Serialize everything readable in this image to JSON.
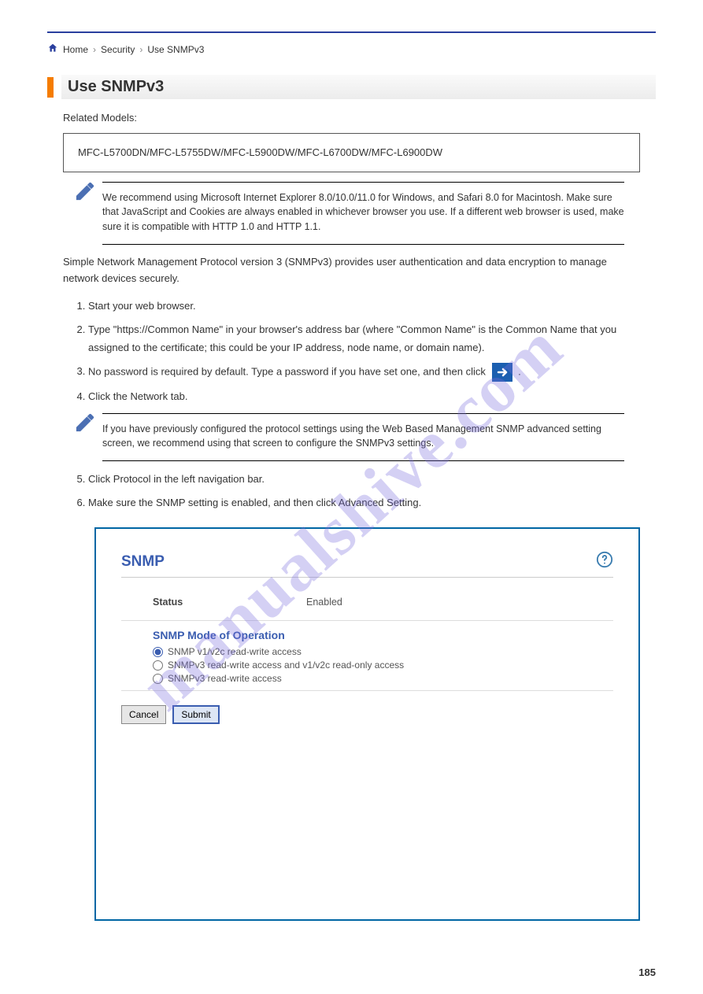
{
  "breadcrumb": {
    "home": "Home",
    "l1": "Security",
    "l2": "Use SNMPv3"
  },
  "section": {
    "title": "Use SNMPv3"
  },
  "intro": "Related Models:",
  "models": "MFC-L5700DN/MFC-L5755DW/MFC-L5900DW/MFC-L6700DW/MFC-L6900DW",
  "note1": "We recommend using Microsoft Internet Explorer 8.0/10.0/11.0 for Windows, and Safari 8.0 for Macintosh. Make sure that JavaScript and Cookies are always enabled in whichever browser you use. If a different web browser is used, make sure it is compatible with HTTP 1.0 and HTTP 1.1.",
  "body1": "Simple Network Management Protocol version 3 (SNMPv3) provides user authentication and data encryption to manage network devices securely.",
  "steps": {
    "s1_a": "Start your web browser.",
    "s2_a": "Type \"https://Common Name\" in your browser's address bar (where \"Common Name\" is the Common Name that you assigned to the certificate; this could be your IP address, node name, or domain name).",
    "s3_a": "No password is required by default. Type a password if you have set one, and then click ",
    "s3_b": ".",
    "s4_a": "Click the Network tab."
  },
  "note2": "If you have previously configured the protocol settings using the Web Based Management SNMP advanced setting screen, we recommend using that screen to configure the SNMPv3 settings.",
  "steps2": {
    "s5_a": "Click Protocol in the left navigation bar.",
    "s6_a": "Make sure the SNMP setting is enabled, and then click Advanced Setting."
  },
  "shot": {
    "title": "SNMP",
    "status_lbl": "Status",
    "status_val": "Enabled",
    "mode_head": "SNMP Mode of Operation",
    "opt1": "SNMP v1/v2c read-write access",
    "opt2": "SNMPv3 read-write access and v1/v2c read-only access",
    "opt3": "SNMPv3 read-write access",
    "cancel": "Cancel",
    "submit": "Submit"
  },
  "page_num": "185",
  "watermark": "manualshive.com"
}
